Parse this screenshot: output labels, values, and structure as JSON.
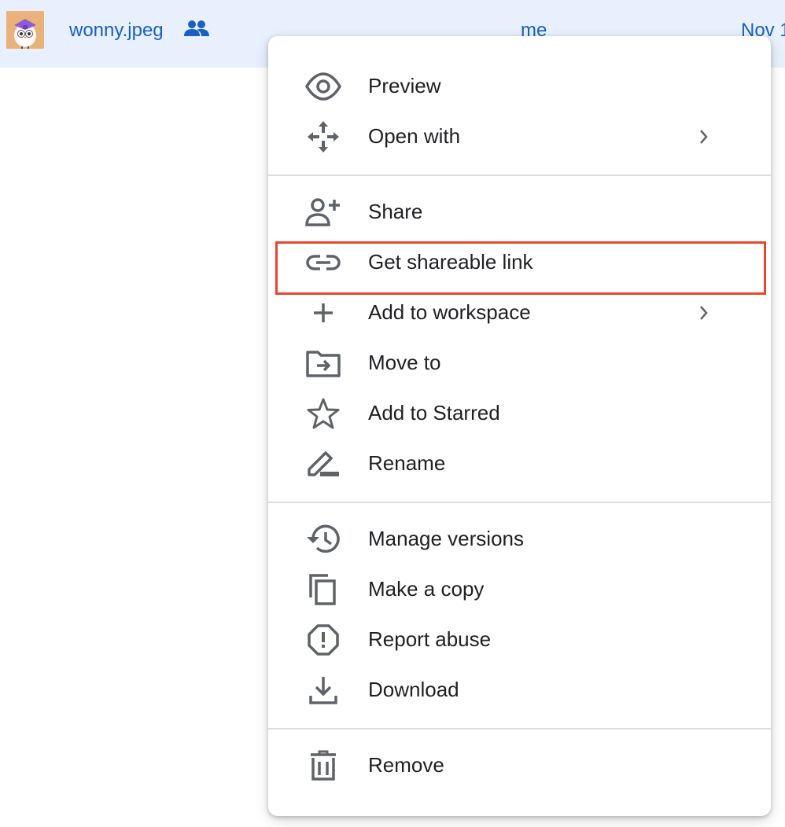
{
  "file_row": {
    "thumbnail_icon": "owl-thumbnail-icon",
    "file_name": "wonny.jpeg",
    "shared_icon": "people-icon",
    "owner": "me",
    "modified": "Nov 1"
  },
  "menu": {
    "items": [
      {
        "label": "Preview",
        "icon": "eye-icon",
        "has_submenu": false
      },
      {
        "label": "Open with",
        "icon": "move-arrows-icon",
        "has_submenu": true
      },
      {
        "label": "Share",
        "icon": "person-add-icon",
        "has_submenu": false
      },
      {
        "label": "Get shareable link",
        "icon": "link-icon",
        "has_submenu": false
      },
      {
        "label": "Add to workspace",
        "icon": "plus-icon",
        "has_submenu": true
      },
      {
        "label": "Move to",
        "icon": "folder-move-icon",
        "has_submenu": false
      },
      {
        "label": "Add to Starred",
        "icon": "star-icon",
        "has_submenu": false
      },
      {
        "label": "Rename",
        "icon": "pencil-icon",
        "has_submenu": false
      },
      {
        "label": "Manage versions",
        "icon": "history-icon",
        "has_submenu": false
      },
      {
        "label": "Make a copy",
        "icon": "copy-icon",
        "has_submenu": false
      },
      {
        "label": "Report abuse",
        "icon": "report-icon",
        "has_submenu": false
      },
      {
        "label": "Download",
        "icon": "download-icon",
        "has_submenu": false
      },
      {
        "label": "Remove",
        "icon": "trash-icon",
        "has_submenu": false
      }
    ],
    "highlighted_item": "Get shareable link"
  },
  "colors": {
    "row_background": "#e8f0fe",
    "link_blue": "#1a5fc4",
    "icon_gray": "#5f6368",
    "highlight_red": "#e8472b"
  }
}
